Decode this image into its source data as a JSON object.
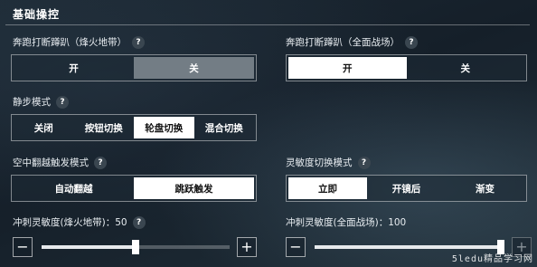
{
  "header": {
    "title": "基础操控"
  },
  "sprint_break_prone_left": {
    "label": "奔跑打断蹲趴（烽火地带）",
    "options": [
      "开",
      "关"
    ],
    "selected": "关"
  },
  "sprint_break_prone_right": {
    "label": "奔跑打断蹲趴（全面战场）",
    "options": [
      "开",
      "关"
    ],
    "selected": "开"
  },
  "quiet_step_mode": {
    "label": "静步模式",
    "options": [
      "关闭",
      "按钮切换",
      "轮盘切换",
      "混合切换"
    ],
    "selected": "轮盘切换"
  },
  "vault_trigger_mode": {
    "label": "空中翻越触发模式",
    "options": [
      "自动翻越",
      "跳跃触发"
    ],
    "selected": "跳跃触发"
  },
  "sensitivity_switch_mode": {
    "label": "灵敏度切换模式",
    "options": [
      "立即",
      "开镜后",
      "渐变"
    ],
    "selected": "立即"
  },
  "sprint_sensitivity_left": {
    "label": "冲刺灵敏度(烽火地带)：50",
    "value": 50,
    "min": 0,
    "max": 100
  },
  "sprint_sensitivity_right": {
    "label": "冲刺灵敏度(全面战场)：100",
    "value": 100,
    "min": 0,
    "max": 100
  },
  "icons": {
    "help": "?",
    "minus": "−",
    "plus": "+"
  },
  "watermark": "5ledu精品学习网"
}
